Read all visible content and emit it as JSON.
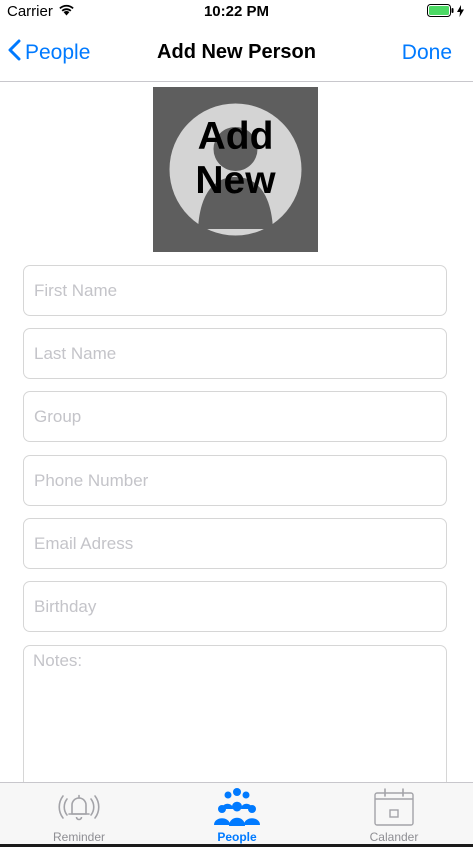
{
  "status_bar": {
    "carrier": "Carrier",
    "time": "10:22 PM",
    "icons": [
      "wifi-icon",
      "battery-icon",
      "charging-bolt-icon"
    ]
  },
  "nav": {
    "back_label": "People",
    "title": "Add New Person",
    "done_label": "Done",
    "accent_color": "#007aff"
  },
  "photo": {
    "line1": "Add",
    "line2": "New",
    "icon": "person-placeholder-icon"
  },
  "form": {
    "first_name": {
      "placeholder": "First Name",
      "value": ""
    },
    "last_name": {
      "placeholder": "Last Name",
      "value": ""
    },
    "group": {
      "placeholder": "Group",
      "value": ""
    },
    "phone": {
      "placeholder": "Phone Number",
      "value": ""
    },
    "email": {
      "placeholder": "Email Adress",
      "value": ""
    },
    "birthday": {
      "placeholder": "Birthday",
      "value": ""
    },
    "notes": {
      "placeholder": "Notes:",
      "value": ""
    }
  },
  "tabs": [
    {
      "label": "Reminder",
      "icon": "bell-icon",
      "active": false
    },
    {
      "label": "People",
      "icon": "people-icon",
      "active": true
    },
    {
      "label": "Calander",
      "icon": "calendar-icon",
      "active": false
    }
  ]
}
